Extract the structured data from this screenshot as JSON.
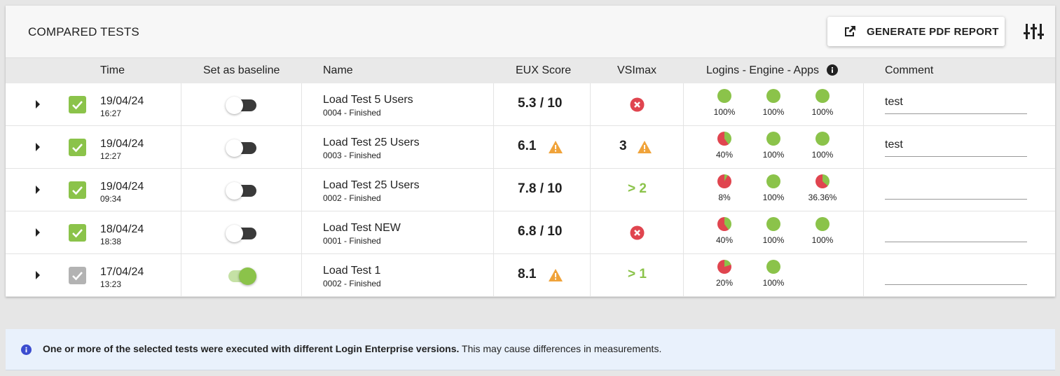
{
  "header": {
    "title": "COMPARED TESTS",
    "pdf_button": "GENERATE PDF REPORT"
  },
  "columns": {
    "time": "Time",
    "baseline": "Set as baseline",
    "name": "Name",
    "eux": "EUX Score",
    "vsimax": "VSImax",
    "lea": "Logins - Engine - Apps",
    "comment": "Comment"
  },
  "rows": [
    {
      "date": "19/04/24",
      "time": "16:27",
      "checked": true,
      "checkbox_color": "#8bc34a",
      "baseline": false,
      "name": "Load Test 5 Users",
      "sub": "0004 - Finished",
      "eux": "5.3 / 10",
      "eux_warning": false,
      "vsimax": "",
      "vsimax_status": "error",
      "pies": [
        {
          "pct": 100,
          "label": "100%"
        },
        {
          "pct": 100,
          "label": "100%"
        },
        {
          "pct": 100,
          "label": "100%"
        }
      ],
      "comment": "test"
    },
    {
      "date": "19/04/24",
      "time": "12:27",
      "checked": true,
      "checkbox_color": "#8bc34a",
      "baseline": false,
      "name": "Load Test 25 Users",
      "sub": "0003 - Finished",
      "eux": "6.1",
      "eux_warning": true,
      "vsimax": "3",
      "vsimax_status": "warning",
      "pies": [
        {
          "pct": 40,
          "label": "40%"
        },
        {
          "pct": 100,
          "label": "100%"
        },
        {
          "pct": 100,
          "label": "100%"
        }
      ],
      "comment": "test"
    },
    {
      "date": "19/04/24",
      "time": "09:34",
      "checked": true,
      "checkbox_color": "#8bc34a",
      "baseline": false,
      "name": "Load Test 25 Users",
      "sub": "0002 - Finished",
      "eux": "7.8 / 10",
      "eux_warning": false,
      "vsimax": "> 2",
      "vsimax_status": "green",
      "pies": [
        {
          "pct": 8,
          "label": "8%"
        },
        {
          "pct": 100,
          "label": "100%"
        },
        {
          "pct": 36.36,
          "label": "36.36%"
        }
      ],
      "comment": ""
    },
    {
      "date": "18/04/24",
      "time": "18:38",
      "checked": true,
      "checkbox_color": "#8bc34a",
      "baseline": false,
      "name": "Load Test NEW",
      "sub": "0001 - Finished",
      "eux": "6.8 / 10",
      "eux_warning": false,
      "vsimax": "",
      "vsimax_status": "error",
      "pies": [
        {
          "pct": 40,
          "label": "40%"
        },
        {
          "pct": 100,
          "label": "100%"
        },
        {
          "pct": 100,
          "label": "100%"
        }
      ],
      "comment": ""
    },
    {
      "date": "17/04/24",
      "time": "13:23",
      "checked": true,
      "checkbox_color": "#b3b3b3",
      "baseline": true,
      "name": "Load Test 1",
      "sub": "0002 - Finished",
      "eux": "8.1",
      "eux_warning": true,
      "vsimax": "> 1",
      "vsimax_status": "green",
      "pies": [
        {
          "pct": 20,
          "label": "20%"
        },
        {
          "pct": 100,
          "label": "100%"
        }
      ],
      "comment": ""
    }
  ],
  "notice": {
    "bold": "One or more of the selected tests were executed with different Login Enterprise versions.",
    "text": " This may cause differences in measurements."
  },
  "colors": {
    "green": "#8bc34a",
    "red": "#e0454f",
    "warning": "#f0a33a",
    "notice_bg": "#e9f1fc"
  }
}
